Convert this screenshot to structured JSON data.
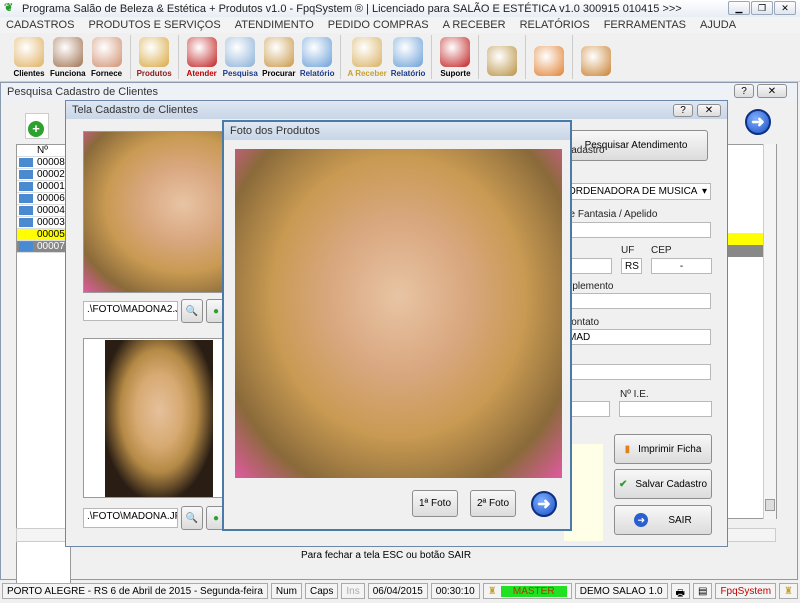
{
  "app": {
    "title": "Programa Salão de Beleza & Estética + Produtos v1.0 - FpqSystem ® | Licenciado para  SALÃO E ESTÉTICA v1.0 300915 010415 >>>"
  },
  "menu": [
    "CADASTROS",
    "PRODUTOS E SERVIÇOS",
    "ATENDIMENTO",
    "PEDIDO COMPRAS",
    "A RECEBER",
    "RELATÓRIOS",
    "FERRAMENTAS",
    "AJUDA"
  ],
  "toolbar": [
    {
      "label": "Clientes",
      "icon": "clients-icon",
      "color": "#000"
    },
    {
      "label": "Funciona",
      "icon": "employees-icon",
      "color": "#000"
    },
    {
      "label": "Fornece",
      "icon": "supplier-icon",
      "color": "#000"
    },
    {
      "label": "Produtos",
      "icon": "products-icon",
      "color": "#8b1a1a"
    },
    {
      "label": "Atender",
      "icon": "attend-icon",
      "color": "#c00000"
    },
    {
      "label": "Pesquisa",
      "icon": "search-icon",
      "color": "#1a3a8b"
    },
    {
      "label": "Procurar",
      "icon": "folder-icon",
      "color": "#000"
    },
    {
      "label": "Relatório",
      "icon": "report-icon",
      "color": "#1a3a8b"
    },
    {
      "label": "A Receber",
      "icon": "receivable-icon",
      "color": "#c8a030"
    },
    {
      "label": "Relatório",
      "icon": "report-icon",
      "color": "#1a3a8b"
    },
    {
      "label": "Suporte",
      "icon": "support-icon",
      "color": "#000"
    },
    {
      "label": "",
      "icon": "coin-icon",
      "color": "#000"
    },
    {
      "label": "",
      "icon": "calculator-icon",
      "color": "#000"
    },
    {
      "label": "",
      "icon": "exit-icon",
      "color": "#000"
    }
  ],
  "search_window": {
    "title": "Pesquisa Cadastro de Clientes",
    "col_header": "Nº",
    "rows": [
      "00008",
      "00002",
      "00001",
      "00006",
      "00004",
      "00003",
      "00005",
      "00007"
    ],
    "footer": "Para fechar a tela ESC ou botão SAIR"
  },
  "client_window": {
    "title": "Tela Cadastro de Clientes",
    "photo1_path": ".\\FOTO\\MADONA2.JPG",
    "photo2_path": ".\\FOTO\\MADONA.JPG",
    "search_attendance": "Pesquisar Atendimento",
    "label_cadastro": "Cadastro",
    "cadastro_value": "ORDENADORA DE MUSICA",
    "label_fantasia": "ne Fantasia / Apelido",
    "label_uf": "UF",
    "label_cep": "CEP",
    "uf_value": "RS",
    "cep_value": "-",
    "label_complemento": "mplemento",
    "label_contato": "Contato",
    "contato_value": "MAD",
    "label_ie": "Nº I.E.",
    "cpf_value": "-",
    "print_button": "Imprimir Ficha",
    "save_button": "Salvar Cadastro",
    "exit_button": "SAIR"
  },
  "photo_dialog": {
    "title": "Foto dos Produtos",
    "first_button": "1ª Foto",
    "second_button": "2ª Foto"
  },
  "statusbar": {
    "location": "PORTO ALEGRE - RS  6 de Abril de 2015 - Segunda-feira",
    "num": "Num",
    "caps": "Caps",
    "ins": "Ins",
    "date": "06/04/2015",
    "time": "00:30:10",
    "user": "MASTER",
    "company": "DEMO SALAO 1.0",
    "brand": "FpqSystem"
  },
  "colors": {
    "user_badge": "#22e022",
    "selected_row": "#ffff00",
    "brand": "#c00000"
  }
}
